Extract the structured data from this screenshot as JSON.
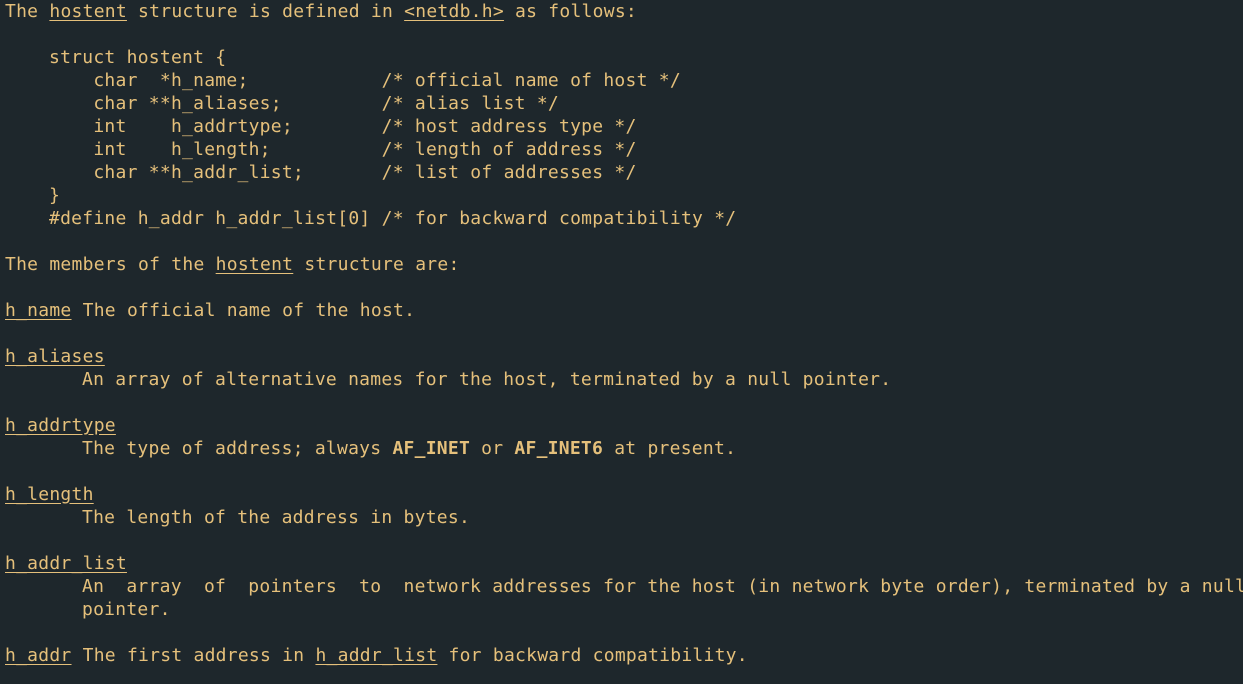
{
  "intro": {
    "pre": "The ",
    "link1": "hostent",
    "mid": " structure is defined in ",
    "link2": "<netdb.h>",
    "post": " as follows:"
  },
  "code": {
    "l1": "struct hostent {",
    "l2": "    char  *h_name;            /* official name of host */",
    "l3": "    char **h_aliases;         /* alias list */",
    "l4": "    int    h_addrtype;        /* host address type */",
    "l5": "    int    h_length;          /* length of address */",
    "l6": "    char **h_addr_list;       /* list of addresses */",
    "l7": "}",
    "l8": "#define h_addr h_addr_list[0] /* for backward compatibility */"
  },
  "members_intro": {
    "pre": "The members of the ",
    "link": "hostent",
    "post": " structure are:"
  },
  "h_name": {
    "term": "h_name",
    "desc": " The official name of the host."
  },
  "h_aliases": {
    "term": "h_aliases",
    "desc": "An array of alternative names for the host, terminated by a null pointer."
  },
  "h_addrtype": {
    "term": "h_addrtype",
    "desc_pre": "The type of address; always ",
    "af_inet": "AF_INET",
    "desc_mid": " or ",
    "af_inet6": "AF_INET6",
    "desc_post": " at present."
  },
  "h_length": {
    "term": "h_length",
    "desc": "The length of the address in bytes."
  },
  "h_addr_list": {
    "term": "h_addr_list",
    "desc1": "An  array  of  pointers  to  network addresses for the host (in network byte order), terminated by a null",
    "desc2": "pointer."
  },
  "h_addr": {
    "term": "h_addr",
    "desc_pre": " The first address in ",
    "link": "h_addr_list",
    "desc_post": " for backward compatibility."
  }
}
